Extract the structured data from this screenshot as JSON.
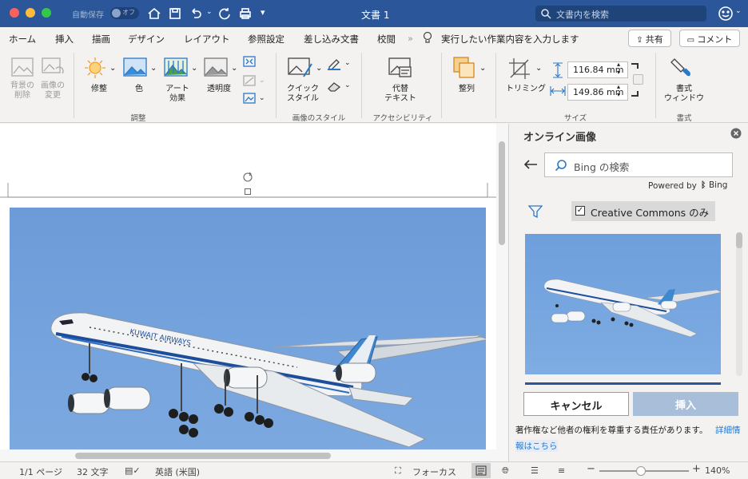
{
  "window": {
    "title": "文書 1",
    "autosave_label": "自動保存",
    "autosave_state": "オフ"
  },
  "search": {
    "placeholder": "文書内を検索"
  },
  "tabs": [
    "ホーム",
    "挿入",
    "描画",
    "デザイン",
    "レイアウト",
    "参照設定",
    "差し込み文書",
    "校閲"
  ],
  "tell_me": "実行したい作業内容を入力します",
  "share_label": "共有",
  "comment_label": "コメント",
  "ribbon": {
    "remove_bg": "背景の\n削除",
    "change_picture": "画像の\n変更",
    "corrections": "修整",
    "color": "色",
    "art_effects": "アート\n効果",
    "transparency": "透明度",
    "quick_styles": "クイック\nスタイル",
    "alt_text": "代替\nテキスト",
    "arrange": "整列",
    "crop": "トリミング",
    "height": "116.84 mm",
    "width": "149.86 mm",
    "format_window": "書式\nウィンドウ",
    "groups": {
      "adjust": "調整",
      "picture_styles": "画像のスタイル",
      "accessibility": "アクセシビリティ",
      "size": "サイズ",
      "format": "書式"
    }
  },
  "pane": {
    "title": "オンライン画像",
    "search_placeholder": "Bing の検索",
    "powered_by": "Powered by",
    "bing": "Bing",
    "cc_only": "Creative Commons のみ",
    "cancel": "キャンセル",
    "insert": "挿入",
    "notice": "著作権など他者の権利を尊重する責任があります。",
    "details_link": "詳細情",
    "details_link2": "報はこちら"
  },
  "image_text": {
    "livery_text": "KUWAIT AIRWAYS"
  },
  "status": {
    "page": "1/1 ページ",
    "words": "32 文字",
    "language": "英語 (米国)",
    "focus": "フォーカス",
    "zoom": "140%"
  },
  "colors": {
    "titlebar": "#2b579a",
    "accent": "#2b579a",
    "insert_btn": "#a9bfd9"
  }
}
